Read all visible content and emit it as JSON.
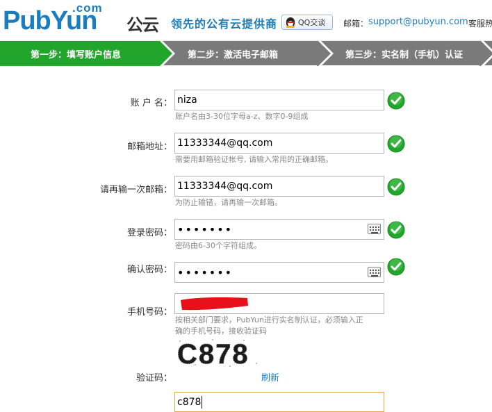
{
  "header": {
    "logo_com": ".com",
    "logo_main": "PubYun",
    "logo_cn": "公云",
    "slogan": "领先的公有云提供商",
    "qq_button": "QQ交谈",
    "email_label": "邮箱：",
    "email_value": "support@pubyun.com",
    "service": "客服热"
  },
  "steps": [
    {
      "label": "第一步：填写账户信息",
      "active": true
    },
    {
      "label": "第二步：激活电子邮箱",
      "active": false
    },
    {
      "label": "第三步：实名制（手机）认证",
      "active": false
    }
  ],
  "colors": {
    "brand": "#1c7dbe",
    "step_active": "#21a52b",
    "step_inactive": "#7a7a7a",
    "ok_green": "#21a52b",
    "highlight": "#e7a54a"
  },
  "form": {
    "username": {
      "label": "账 户 名：",
      "value": "niza",
      "hint": "账户名由3-30位字母a-z、数字0-9组成"
    },
    "email": {
      "label": "邮箱地址：",
      "value": "11333344@qq.com",
      "hint": "需要用邮箱验证帐号, 请输入常用的正确邮箱。"
    },
    "email_confirm": {
      "label": "请再输一次邮箱：",
      "value": "11333344@qq.com",
      "hint": "为防止输错，请再输一次邮箱。"
    },
    "password": {
      "label": "登录密码：",
      "value": "•••••••",
      "hint": "密码由6-30个字符组成。"
    },
    "password_confirm": {
      "label": "确认密码：",
      "value": "•••••••"
    },
    "phone": {
      "label": "手机号码：",
      "hint_line1": "按相关部门要求，PubYun进行实名制认证，必须输入正",
      "hint_line2": "确的手机号码，接收验证码"
    },
    "captcha": {
      "label": "验证码：",
      "image_text": "C878",
      "refresh": "刷新",
      "value": "c878"
    }
  }
}
